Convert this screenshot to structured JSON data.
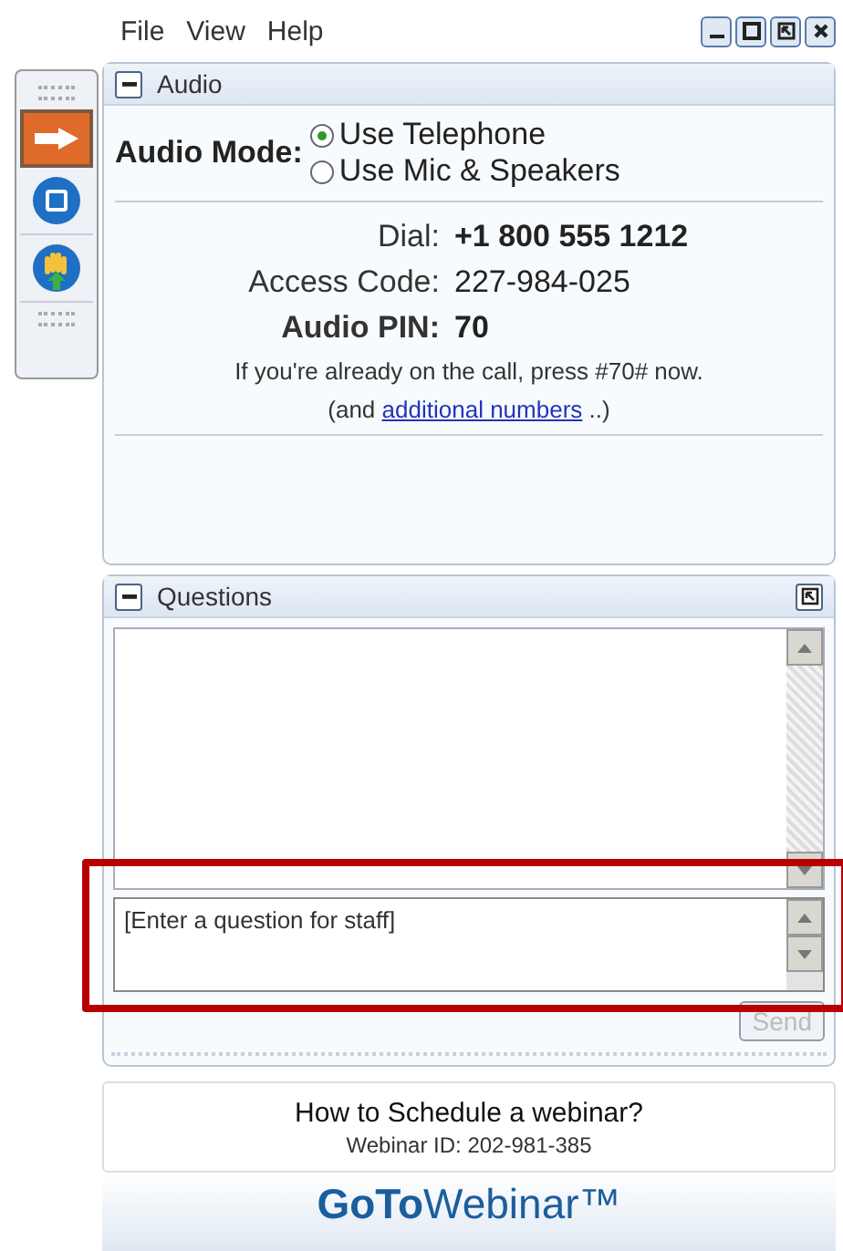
{
  "menu": [
    {
      "label": "File"
    },
    {
      "label": "View"
    },
    {
      "label": "Help"
    }
  ],
  "audio": {
    "title": "Audio",
    "mode_label": "Audio Mode:",
    "modes": [
      {
        "label": "Use Telephone",
        "selected": true
      },
      {
        "label": "Use Mic & Speakers",
        "selected": false
      }
    ],
    "details": [
      {
        "label": "Dial:",
        "value": "+1 800 555 1212",
        "bold": false
      },
      {
        "label": "Access Code:",
        "value": "227-984-025",
        "bold": false
      },
      {
        "label": "Audio PIN:",
        "value": "70",
        "bold": true
      }
    ],
    "note": "If you're already on the call, press #70# now.",
    "more_prefix": "(and",
    "more_link": "additional numbers",
    "more_suffix": "..)"
  },
  "questions": {
    "title": "Questions",
    "placeholder": "[Enter a question for staff]",
    "send": {
      "label": "Send",
      "disabled": true
    },
    "highlighted": true
  },
  "info": {
    "title": "How to Schedule a webinar?",
    "webinar_id": "Webinar ID: 202-981-385"
  },
  "logo": "**GoTo**Webinar™"
}
